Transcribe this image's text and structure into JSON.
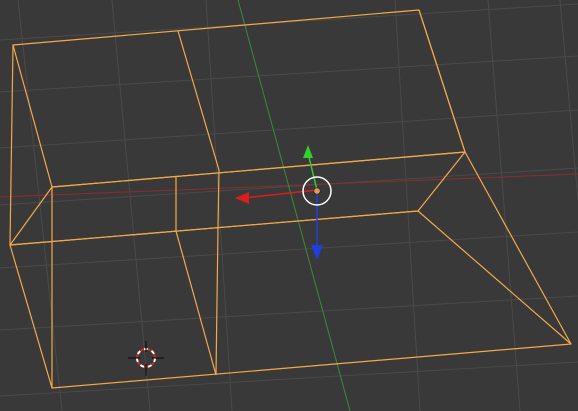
{
  "viewport": {
    "background_color": "#393939",
    "grid_color": "#4a4a4a",
    "x_axis_color": "#8a2e2e",
    "y_axis_color": "#3a8a3a",
    "selection_wire_color": "#f3a94a"
  },
  "gizmo": {
    "x_color": "#d81f1f",
    "y_color": "#2ed12e",
    "z_color": "#1f3fe0",
    "pivot_color": "#e39a55",
    "ring_color": "#ffffff"
  },
  "cursor_3d": {
    "icon": "3d-cursor-icon",
    "ring_color_a": "#d22222",
    "ring_color_b": "#ffffff",
    "crosshair_color": "#111111"
  }
}
